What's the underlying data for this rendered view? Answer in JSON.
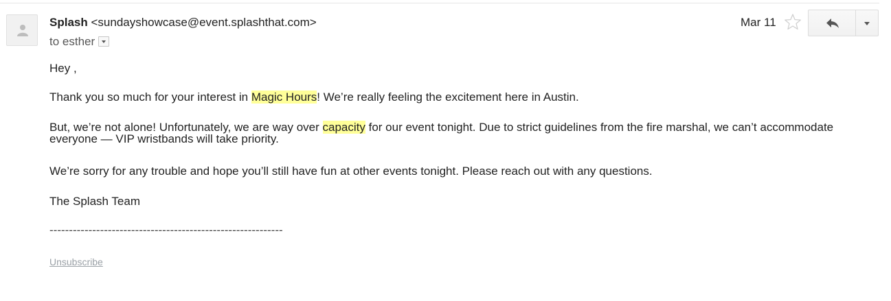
{
  "sender": {
    "name": "Splash",
    "email": "<sundayshowcase@event.splashthat.com>"
  },
  "recipient": {
    "to_text": "to esther"
  },
  "date": "Mar 11",
  "body": {
    "greeting": "Hey ,",
    "p1": {
      "before": "Thank you so much for your interest in ",
      "highlight": "Magic Hours",
      "after": "! We’re really feeling the excitement here in Austin."
    },
    "p2": {
      "before": "But, we’re not alone! Unfortunately, we are way over ",
      "highlight": "capacity",
      "after": " for our event tonight. Due to strict guidelines from the fire marshal, we can’t accommodate everyone — VIP wristbands will take priority."
    },
    "p3": "We’re sorry for any trouble and hope you’ll still have fun at other events tonight. Please reach out with any questions.",
    "signoff": "The Splash Team",
    "divider": "------------------------------------------------------------"
  },
  "footer": {
    "unsubscribe_label": "Unsubscribe"
  },
  "icons": {
    "avatar": "person-icon",
    "star": "star-outline-icon",
    "reply": "reply-arrow-icon",
    "more": "chevron-down-icon"
  },
  "colors": {
    "highlight": "#ffff99",
    "link_muted": "#9aa0a6"
  }
}
